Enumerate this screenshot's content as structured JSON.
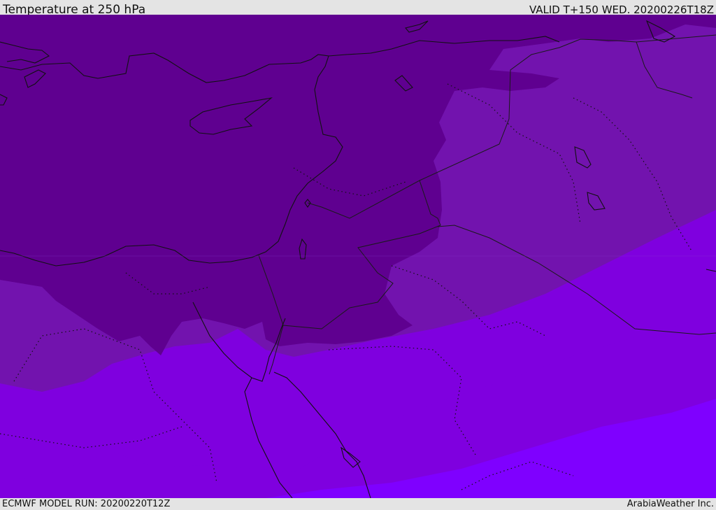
{
  "header": {
    "title": "Temperature at 250 hPa",
    "valid": "VALID T+150 WED. 20200226T18Z"
  },
  "footer": {
    "model_run": "ECMWF MODEL RUN: 20200220T12Z",
    "credit": "ArabiaWeather Inc."
  },
  "colors": {
    "band_coldest": "#5f0090",
    "band_cold": "#7213ae",
    "band_mid": "#7f00df",
    "band_warm": "#7f00ff",
    "coastline": "#111111",
    "border": "#1a1a1a"
  }
}
